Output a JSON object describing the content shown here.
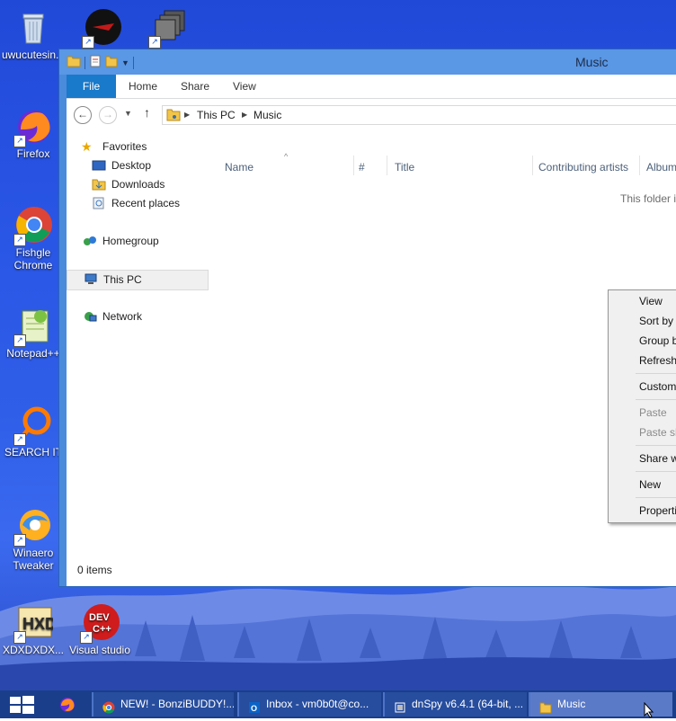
{
  "desktop": {
    "icons": [
      {
        "label": "uwucutesin..."
      },
      {
        "label": "Firefox"
      },
      {
        "label": "Fishgle Chrome"
      },
      {
        "label": "Notepad++"
      },
      {
        "label": "SEARCH IT"
      },
      {
        "label": "Winaero Tweaker"
      },
      {
        "label": "XDXDXDX..."
      },
      {
        "label": "Visual studio"
      }
    ]
  },
  "window": {
    "title": "Music",
    "ribbon_tabs": [
      "File",
      "Home",
      "Share",
      "View"
    ],
    "address": {
      "root": "This PC",
      "folder": "Music"
    },
    "nav": {
      "favorites": "Favorites",
      "desktop": "Desktop",
      "downloads": "Downloads",
      "recent": "Recent places",
      "homegroup": "Homegroup",
      "thispc": "This PC",
      "network": "Network"
    },
    "columns": [
      "Name",
      "#",
      "Title",
      "Contributing artists",
      "Album"
    ],
    "empty_message": "This folder is empty.",
    "status": "0 items"
  },
  "context_menu": {
    "items": [
      "View",
      "Sort by",
      "Group by",
      "Refresh",
      "Customize this folder...",
      "Paste",
      "Paste shortcut",
      "Share with",
      "New",
      "Properties"
    ]
  },
  "taskbar": {
    "buttons": [
      {
        "label": "NEW! - BonziBUDDY!..."
      },
      {
        "label": "Inbox - vm0b0t@co..."
      },
      {
        "label": "dnSpy v6.4.1 (64-bit, ..."
      },
      {
        "label": "Music"
      }
    ]
  },
  "colors": {
    "file_tab": "#1979ca",
    "taskbar": "#1a3e8a",
    "window_frame": "#4a8bdc"
  }
}
